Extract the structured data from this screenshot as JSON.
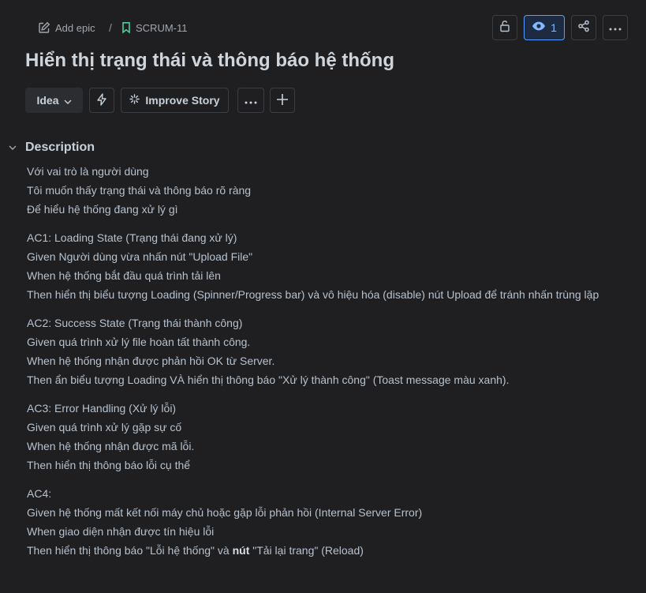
{
  "breadcrumb": {
    "add_epic_label": "Add epic",
    "separator": "/",
    "issue_key": "SCRUM-11"
  },
  "header_actions": {
    "watch_count": "1"
  },
  "title": "Hiển thị trạng thái và thông báo hệ thống",
  "toolbar": {
    "status_label": "Idea",
    "improve_label": "Improve Story"
  },
  "description": {
    "heading": "Description",
    "paragraphs": [
      [
        "Với vai trò là người dùng",
        "Tôi muốn thấy trạng thái và thông báo rõ ràng",
        "Để hiểu hệ thống đang xử lý gì"
      ],
      [
        "AC1: Loading State (Trạng thái đang xử lý)",
        "Given Người dùng vừa nhấn nút \"Upload File\"",
        "When hệ thống bắt đầu quá trình tải lên",
        "Then hiển thị biểu tượng Loading (Spinner/Progress bar) và vô hiệu hóa (disable) nút Upload để tránh nhấn trùng lặp"
      ],
      [
        "AC2: Success State (Trạng thái thành công)",
        "Given quá trình xử lý file hoàn tất thành công.",
        "When hệ thống nhận được phản hồi OK từ Server.",
        "Then ẩn biểu tượng Loading VÀ hiển thị thông báo \"Xử lý thành công\" (Toast message màu xanh)."
      ],
      [
        "AC3: Error Handling (Xử lý lỗi)",
        "Given quá trình xử lý gặp sự cố",
        "When hệ thống nhận được mã lỗi.",
        "Then hiển thị thông báo lỗi cụ thể"
      ],
      [
        "AC4:",
        "Given hệ thống mất kết nối máy chủ hoặc gặp lỗi phản hồi (Internal Server Error)",
        "When giao diện nhận được tín hiệu lỗi"
      ]
    ],
    "last_line": {
      "prefix": "Then hiển thị thông báo \"Lỗi hệ thống\" và ",
      "bold": "nút",
      "suffix": " \"Tải lại trang\" (Reload)"
    }
  },
  "colors": {
    "background": "#1f1f21",
    "text": "#b6c2cf",
    "accent": "#579dff",
    "story_icon": "#4bce97"
  }
}
